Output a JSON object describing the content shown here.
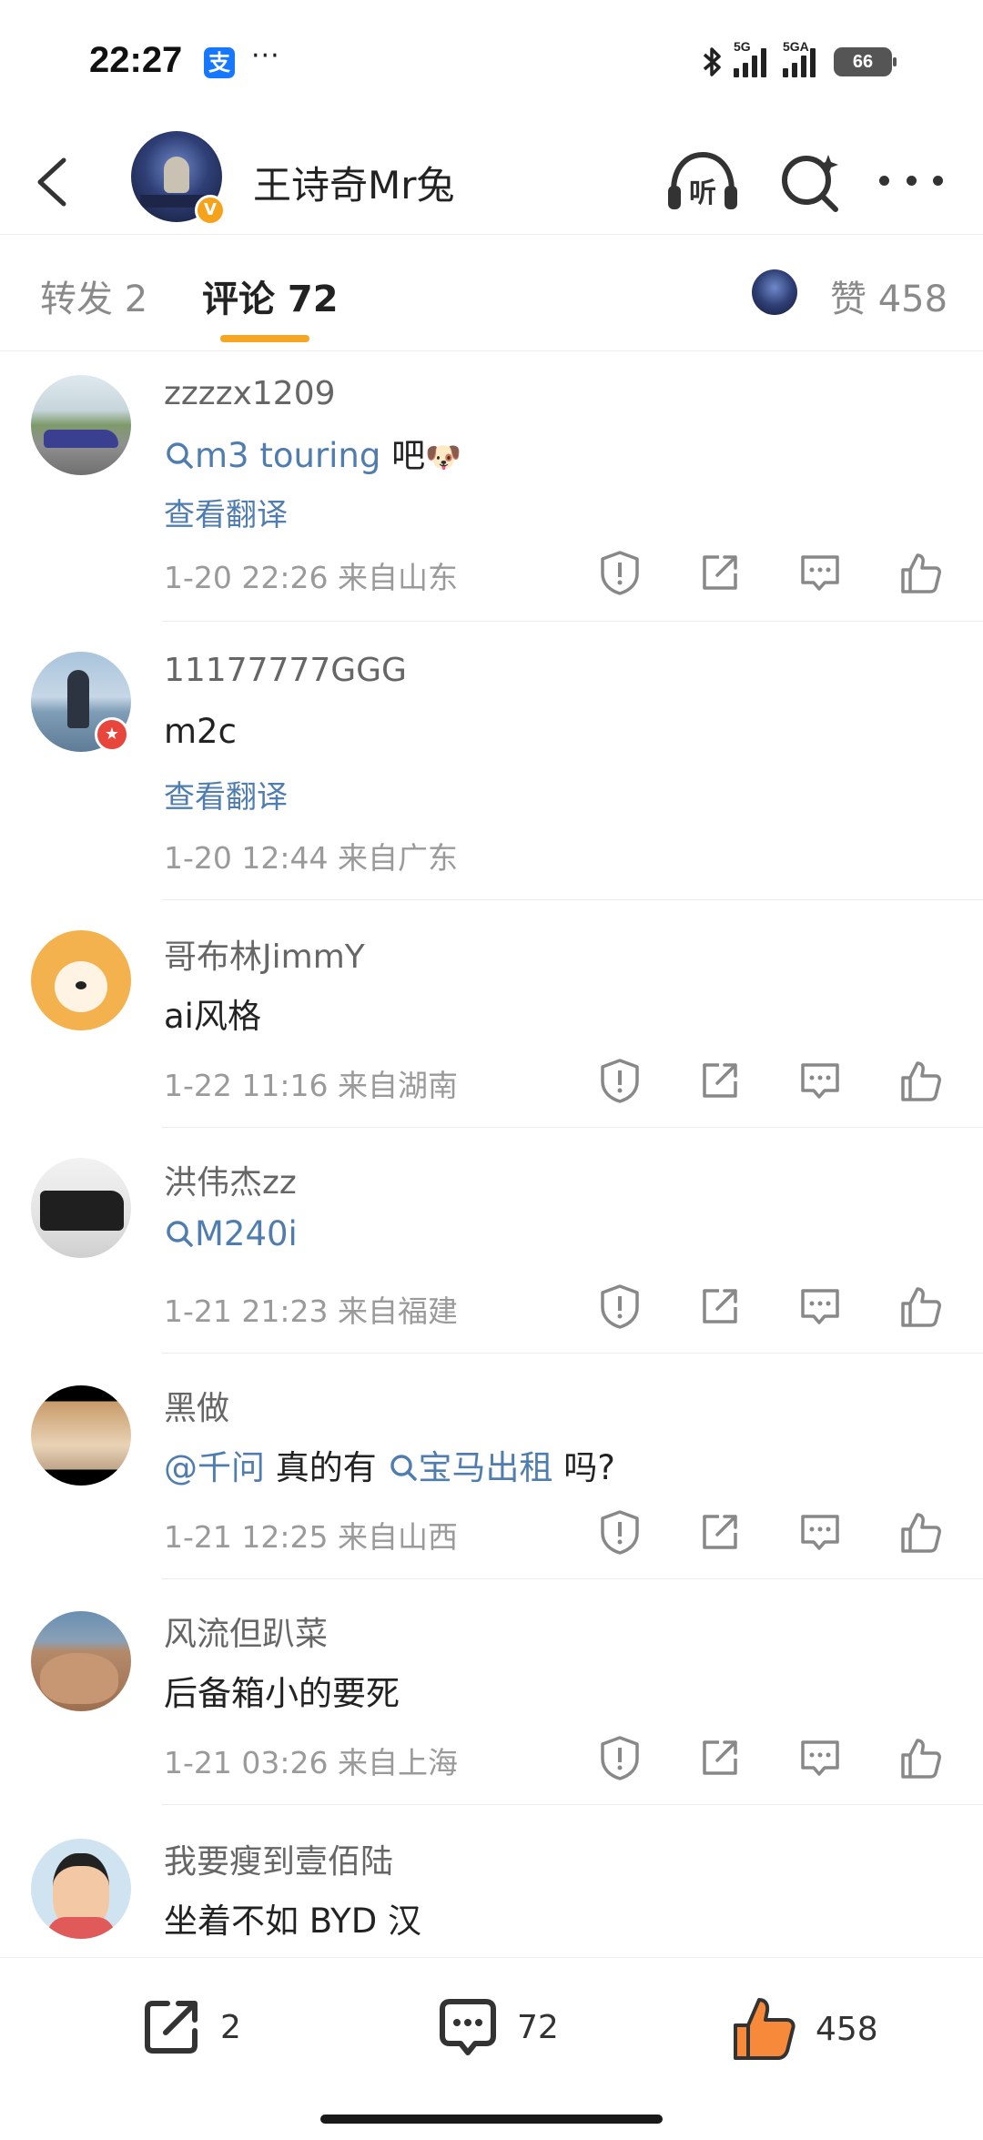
{
  "status_bar": {
    "time": "22:27",
    "alipay_glyph": "支",
    "more": "···",
    "bluetooth_icon": "bluetooth-icon",
    "signal1_tag": "5G",
    "signal2_tag": "5GA",
    "battery": "66"
  },
  "header": {
    "title": "王诗奇Mr兔",
    "verified_mark": "V",
    "listen_label": "听"
  },
  "tabs": {
    "repost": "转发 2",
    "comments": "评论 72",
    "likes": "赞 458"
  },
  "translate_label": "查看翻译",
  "comments": [
    {
      "name": "zzzzx1209",
      "text_topic": "m3 touring",
      "text_after": " 吧",
      "emoji": "🐶",
      "has_translate": true,
      "meta": "1-20 22:26  来自山东"
    },
    {
      "name": "11177777GGG",
      "text": "m2c",
      "has_translate": true,
      "meta": "1-20 12:44  来自广东"
    },
    {
      "name": "哥布林JimmY",
      "text": "ai风格",
      "meta": "1-22 11:16  来自湖南"
    },
    {
      "name": "洪伟杰zz",
      "text_topic": "M240i",
      "meta": "1-21 21:23  来自福建"
    },
    {
      "name": "黑做",
      "mention": "@千问",
      "text_mid": " 真的有 ",
      "text_topic": "宝马出租",
      "text_after": " 吗?",
      "meta": "1-21 12:25  来自山西"
    },
    {
      "name": "风流但趴菜",
      "text": "后备箱小的要死",
      "meta": "1-21 03:26  来自上海"
    },
    {
      "name": "我要瘦到壹佰陆",
      "text": "坐着不如 BYD 汉"
    }
  ],
  "bottom_bar": {
    "repost_count": "2",
    "comment_count": "72",
    "like_count": "458"
  },
  "colors": {
    "accent": "#f5a623",
    "link": "#507daf",
    "like_orange": "#f7893b"
  }
}
